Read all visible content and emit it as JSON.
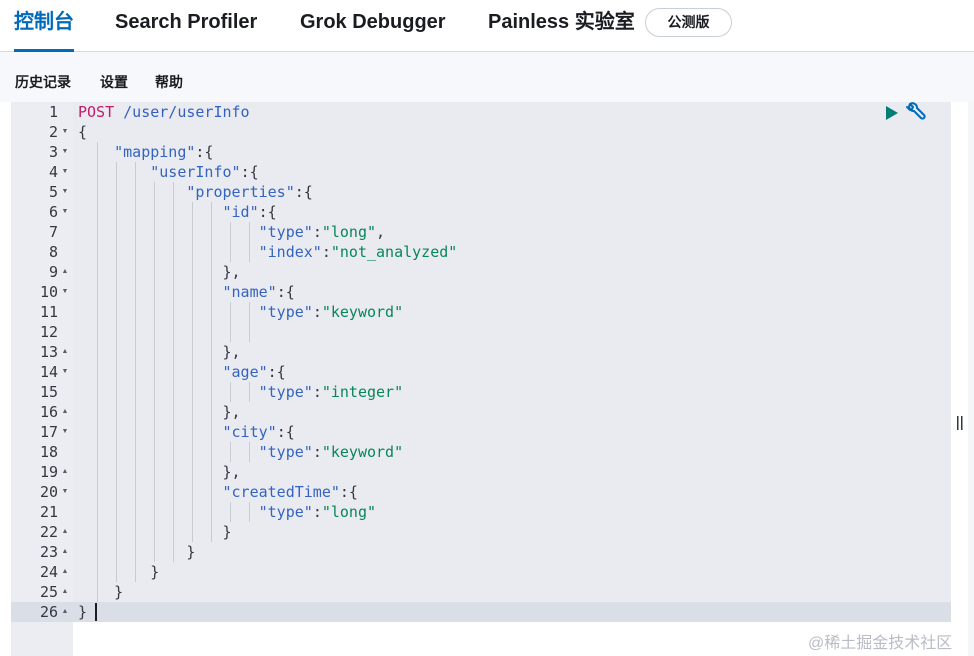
{
  "top_tabs": {
    "console": "控制台",
    "search_profiler": "Search Profiler",
    "grok_debugger": "Grok Debugger",
    "painless_lab": "Painless 实验室",
    "beta_badge": "公测版"
  },
  "menu": {
    "history": "历史记录",
    "settings": "设置",
    "help": "帮助"
  },
  "editor": {
    "line_numbers": [
      "1",
      "2",
      "3",
      "4",
      "5",
      "6",
      "7",
      "8",
      "9",
      "10",
      "11",
      "12",
      "13",
      "14",
      "15",
      "16",
      "17",
      "18",
      "19",
      "20",
      "21",
      "22",
      "23",
      "24",
      "25",
      "26"
    ],
    "request": {
      "method": "POST",
      "path": "/user/userInfo"
    },
    "keys": {
      "mapping": "\"mapping\"",
      "userInfo": "\"userInfo\"",
      "properties": "\"properties\"",
      "id": "\"id\"",
      "type": "\"type\"",
      "index": "\"index\"",
      "name": "\"name\"",
      "age": "\"age\"",
      "city": "\"city\"",
      "createdTime": "\"createdTime\""
    },
    "values": {
      "long": "\"long\"",
      "not_analyzed": "\"not_analyzed\"",
      "keyword": "\"keyword\"",
      "integer": "\"integer\""
    },
    "icons": {
      "run": "play-icon",
      "settings": "wrench-icon"
    }
  },
  "watermark": "@稀土掘金技术社区",
  "colors": {
    "accent": "#006bb8",
    "method": "#c41a6b",
    "key": "#3463c1",
    "string": "#098658",
    "play": "#017d73"
  }
}
